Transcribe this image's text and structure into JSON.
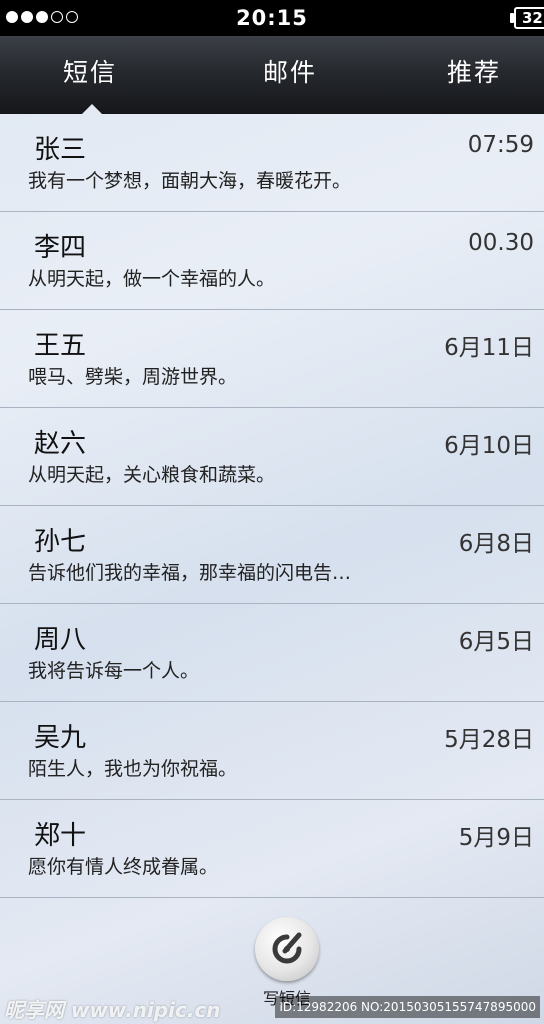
{
  "status_bar": {
    "time": "20:15",
    "battery": "32",
    "signal_dots": [
      "filled",
      "filled",
      "filled",
      "empty",
      "empty"
    ]
  },
  "tabs": [
    {
      "label": "短信",
      "active": true
    },
    {
      "label": "邮件",
      "active": false
    },
    {
      "label": "推荐",
      "active": false
    }
  ],
  "messages": [
    {
      "name": "张三",
      "time": "07:59",
      "preview": "我有一个梦想，面朝大海，春暖花开。"
    },
    {
      "name": "李四",
      "time": "00.30",
      "preview": "从明天起，做一个幸福的人。"
    },
    {
      "name": "王五",
      "time": "6月11日",
      "preview": "喂马、劈柴，周游世界。"
    },
    {
      "name": "赵六",
      "time": "6月10日",
      "preview": "从明天起，关心粮食和蔬菜。"
    },
    {
      "name": "孙七",
      "time": "6月8日",
      "preview": "告诉他们我的幸福，那幸福的闪电告…"
    },
    {
      "name": "周八",
      "time": "6月5日",
      "preview": "我将告诉每一个人。"
    },
    {
      "name": "吴九",
      "time": "5月28日",
      "preview": "陌生人，我也为你祝福。"
    },
    {
      "name": "郑十",
      "time": "5月9日",
      "preview": "愿你有情人终成眷属。"
    }
  ],
  "compose": {
    "label": "写短信",
    "icon": "compose-icon"
  },
  "watermark": {
    "left_text": "昵享网 www.nipic.cn",
    "right_text": "ID:12982206 NO:20150305155747895000"
  }
}
